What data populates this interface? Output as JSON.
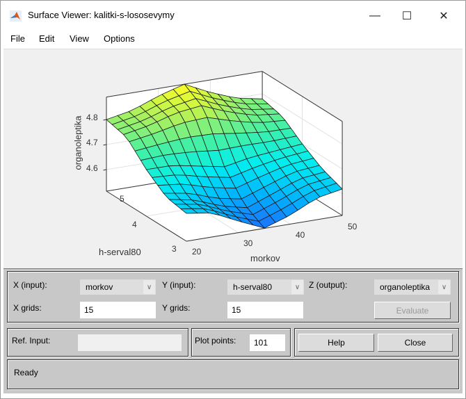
{
  "window": {
    "title": "Surface Viewer: kalitki-s-lososevymy",
    "minimize": "—",
    "maximize": "☐",
    "close": "✕"
  },
  "menu": [
    "File",
    "Edit",
    "View",
    "Options"
  ],
  "controls": {
    "x_input_label": "X (input):",
    "x_input_value": "morkov",
    "y_input_label": "Y (input):",
    "y_input_value": "h-serval80",
    "z_output_label": "Z (output):",
    "z_output_value": "organoleptika",
    "x_grids_label": "X grids:",
    "x_grids_value": "15",
    "y_grids_label": "Y grids:",
    "y_grids_value": "15",
    "evaluate_label": "Evaluate",
    "ref_input_label": "Ref. Input:",
    "ref_input_value": "",
    "plot_points_label": "Plot points:",
    "plot_points_value": "101",
    "help_label": "Help",
    "close_label": "Close",
    "dropdown_arrow": "∨"
  },
  "status": "Ready",
  "chart_data": {
    "type": "surface",
    "xlabel": "morkov",
    "ylabel": "h-serval80",
    "zlabel": "organoleptika",
    "xlim": [
      20,
      50
    ],
    "ylim": [
      3,
      5
    ],
    "zlim": [
      4.514,
      4.89
    ],
    "xticks": [
      "20",
      "30",
      "40",
      "50"
    ],
    "yticks": [
      "3",
      "4",
      "5"
    ],
    "zticks": [
      "4.6",
      "4.7",
      "4.8"
    ],
    "grid_size": [
      15,
      15
    ],
    "control_x": [
      20,
      25,
      30,
      35,
      40,
      45,
      50
    ],
    "control_y": [
      3,
      3.5,
      4,
      4.5,
      5
    ],
    "control_z": [
      [
        4.625,
        4.61,
        4.56,
        4.515,
        4.55,
        4.6,
        4.62
      ],
      [
        4.64,
        4.62,
        4.58,
        4.56,
        4.6,
        4.64,
        4.65
      ],
      [
        4.7,
        4.7,
        4.68,
        4.66,
        4.68,
        4.69,
        4.7
      ],
      [
        4.78,
        4.8,
        4.83,
        4.84,
        4.8,
        4.77,
        4.76
      ],
      [
        4.8,
        4.82,
        4.86,
        4.89,
        4.84,
        4.8,
        4.78
      ]
    ],
    "colormap": [
      "#1e6eff",
      "#00b4ff",
      "#00eef0",
      "#40f0a8",
      "#a8f060",
      "#ffff20"
    ]
  }
}
